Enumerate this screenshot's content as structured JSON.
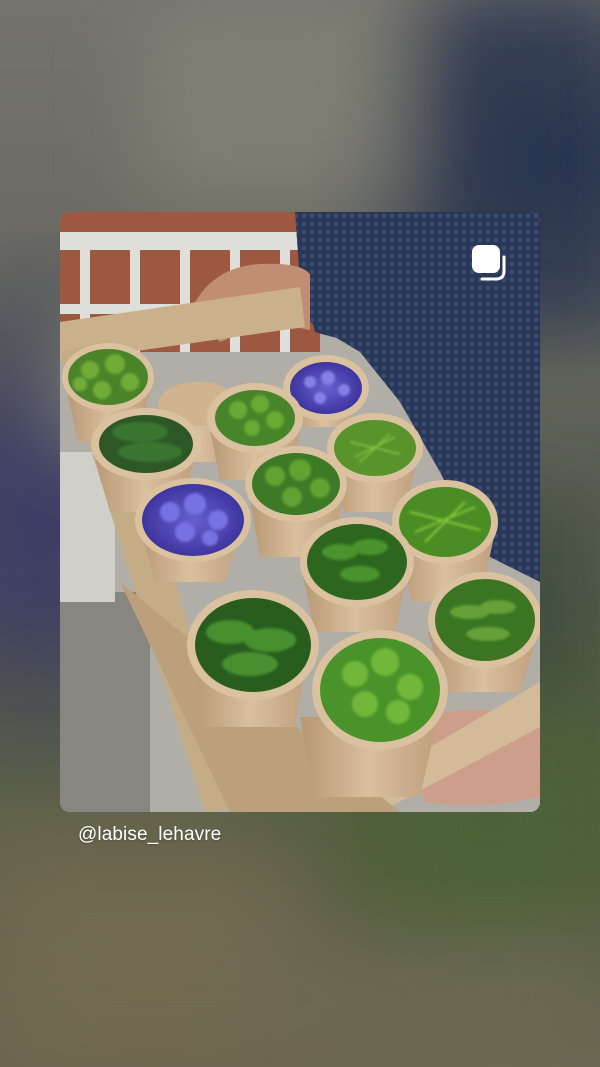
{
  "post": {
    "username": "@labise_lehavre"
  },
  "icons": {
    "corner_icon": "instagram-logo-icon"
  },
  "colors": {
    "handle_text": "#ffffff",
    "background_top": "#74736e",
    "background_bottom": "#6c6752"
  }
}
